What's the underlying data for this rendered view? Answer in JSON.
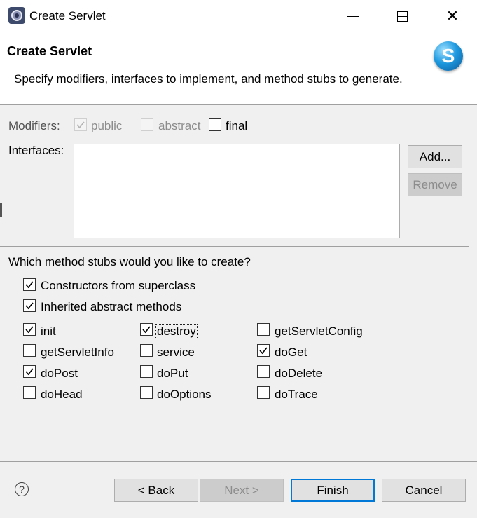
{
  "window": {
    "title": "Create Servlet",
    "app_icon": "eclipse-gear-icon",
    "controls": [
      "minimize-icon",
      "maximize-icon",
      "close-icon"
    ]
  },
  "banner": {
    "title": "Create Servlet",
    "description": "Specify modifiers, interfaces to implement, and method stubs to generate.",
    "logo_letter": "S"
  },
  "modifiers": {
    "label": "Modifiers:",
    "public": {
      "label": "public",
      "checked": true,
      "enabled": false
    },
    "abstract": {
      "label": "abstract",
      "checked": false,
      "enabled": false
    },
    "final": {
      "label": "final",
      "checked": false,
      "enabled": true
    }
  },
  "interfaces": {
    "label": "Interfaces:",
    "items": [],
    "add_label": "Add...",
    "remove_label": "Remove"
  },
  "stubs": {
    "question": "Which method stubs would you like to create?",
    "constructors": {
      "label": "Constructors from superclass",
      "checked": true
    },
    "inherited": {
      "label": "Inherited abstract methods",
      "checked": true
    },
    "methods": [
      {
        "label": "init",
        "checked": true
      },
      {
        "label": "destroy",
        "checked": true
      },
      {
        "label": "getServletConfig",
        "checked": false
      },
      {
        "label": "getServletInfo",
        "checked": false
      },
      {
        "label": "service",
        "checked": false
      },
      {
        "label": "doGet",
        "checked": true
      },
      {
        "label": "doPost",
        "checked": true
      },
      {
        "label": "doPut",
        "checked": false
      },
      {
        "label": "doDelete",
        "checked": false
      },
      {
        "label": "doHead",
        "checked": false
      },
      {
        "label": "doOptions",
        "checked": false
      },
      {
        "label": "doTrace",
        "checked": false
      }
    ]
  },
  "footer": {
    "help_glyph": "?",
    "back_label": "< Back",
    "next_label": "Next >",
    "finish_label": "Finish",
    "cancel_label": "Cancel"
  },
  "colors": {
    "default_button_border": "#0078d7",
    "logo_blue": "#1e9ae0"
  }
}
